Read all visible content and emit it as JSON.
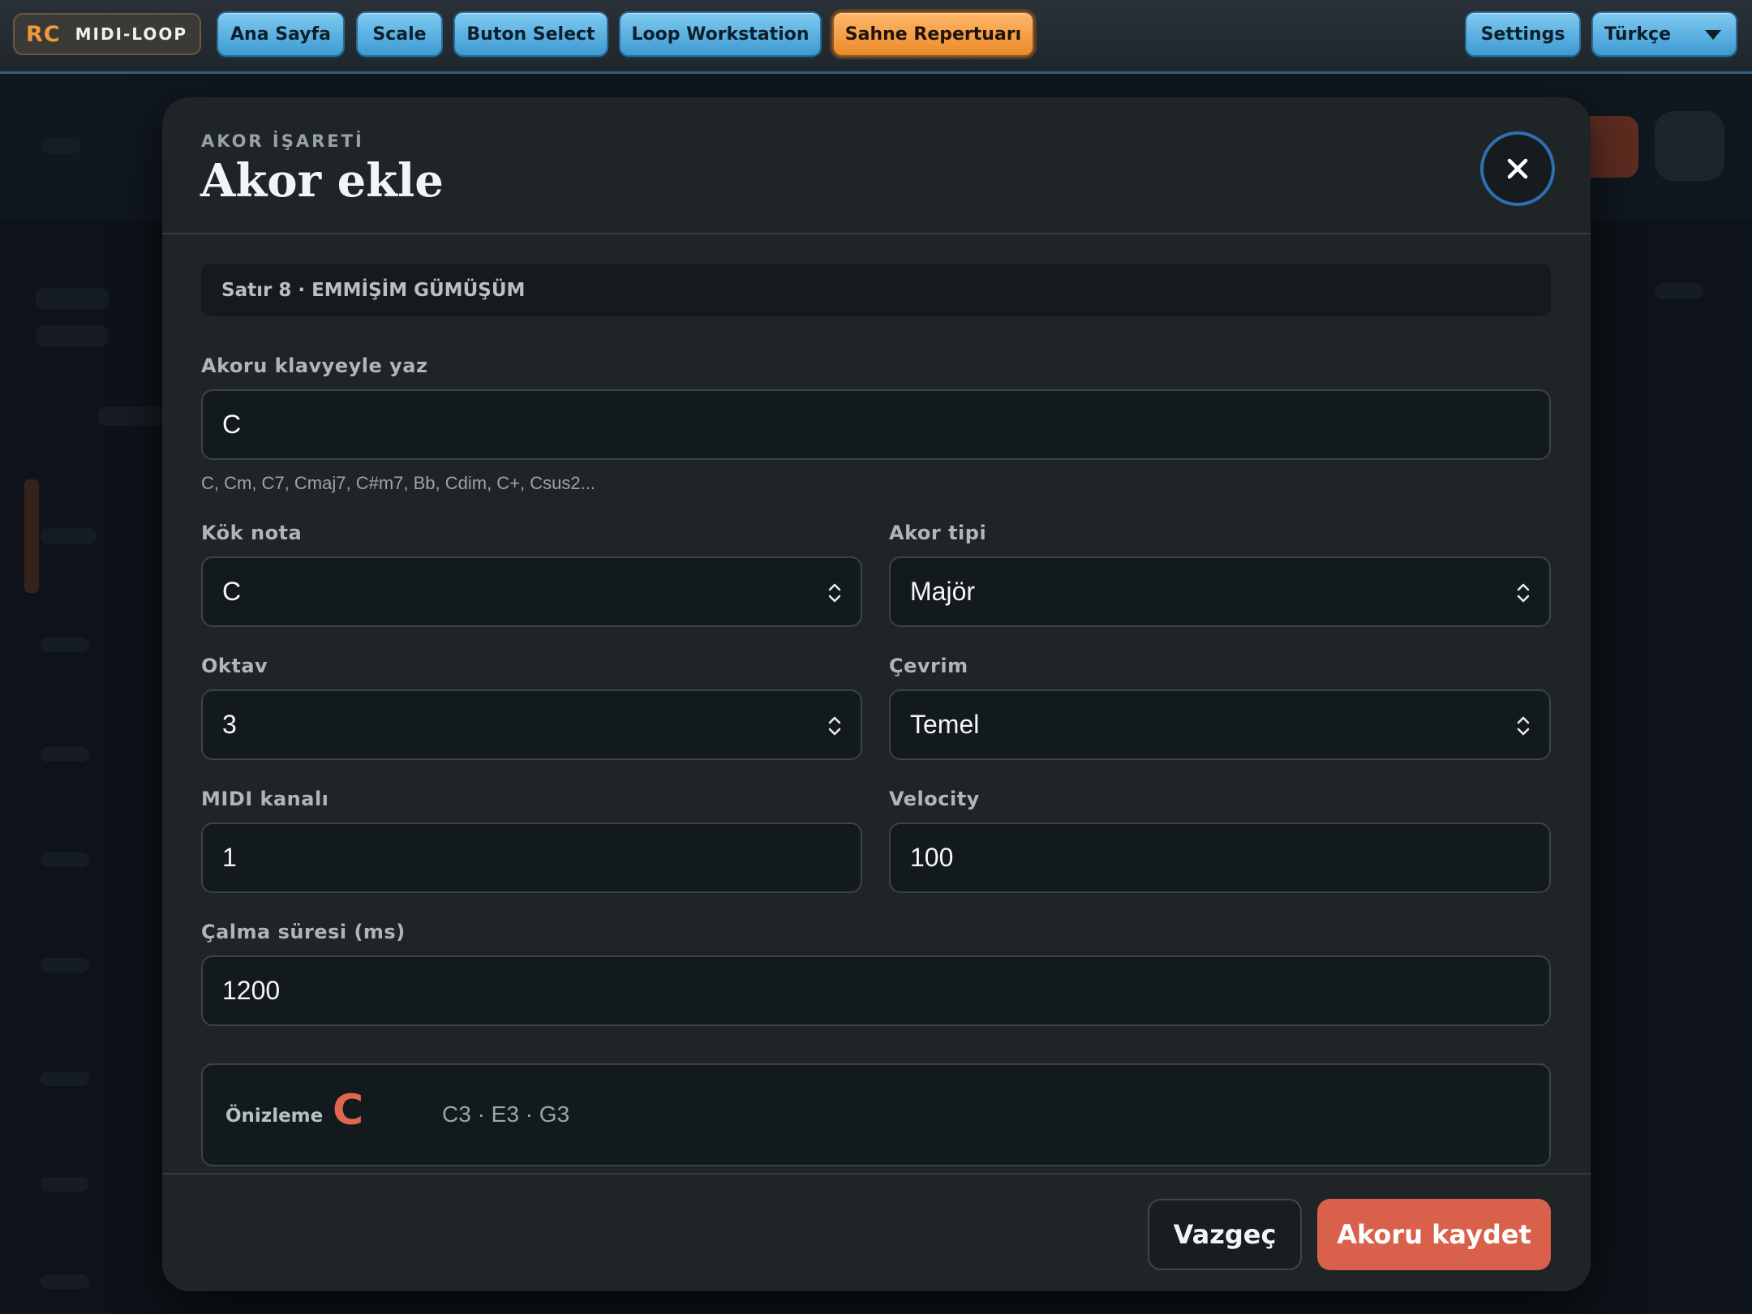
{
  "topbar": {
    "brand_mark": "RC",
    "brand_name": "MIDI-LOOP",
    "nav": [
      {
        "label": "Ana Sayfa"
      },
      {
        "label": "Scale"
      },
      {
        "label": "Buton Select"
      },
      {
        "label": "Loop Workstation"
      },
      {
        "label": "Sahne Repertuarı",
        "active": true
      }
    ],
    "settings_label": "Settings",
    "language_selected": "Türkçe",
    "accent_color": "#3d9ad3",
    "active_color": "#ec8a2a"
  },
  "modal": {
    "eyebrow": "AKOR İŞARETİ",
    "title": "Akor ekle",
    "close_icon": "close-icon",
    "context": "Satır 8 · EMMİŞİM GÜMÜŞÜM",
    "chord_input": {
      "label": "Akoru klavyeyle yaz",
      "value": "C",
      "hint": "C, Cm, C7, Cmaj7, C#m7, Bb, Cdim, C+, Csus2..."
    },
    "root_note": {
      "label": "Kök nota",
      "value": "C"
    },
    "chord_type": {
      "label": "Akor tipi",
      "value": "Majör"
    },
    "octave": {
      "label": "Oktav",
      "value": "3"
    },
    "inversion": {
      "label": "Çevrim",
      "value": "Temel"
    },
    "midi_channel": {
      "label": "MIDI kanalı",
      "value": "1"
    },
    "velocity": {
      "label": "Velocity",
      "value": "100"
    },
    "duration": {
      "label": "Çalma süresi (ms)",
      "value": "1200"
    },
    "preview": {
      "label": "Önizleme",
      "chord": "C",
      "notes": "C3 · E3 · G3",
      "chord_color": "#e0664e"
    },
    "cancel_label": "Vazgeç",
    "save_label": "Akoru kaydet",
    "save_color": "#d9604a"
  }
}
